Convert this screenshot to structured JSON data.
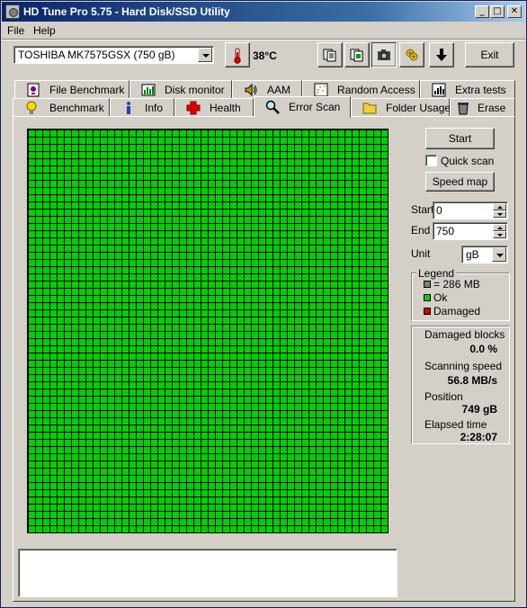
{
  "window": {
    "title": "HD Tune Pro 5.75 - Hard Disk/SSD Utility",
    "controls": [
      "_",
      "□",
      "✕"
    ]
  },
  "menu": [
    "File",
    "Help"
  ],
  "toolbar": {
    "drive": "TOSHIBA MK7575GSX (750 gB)",
    "temperature": "38",
    "temperature_unit": "°C",
    "exit_label": "Exit",
    "icons": [
      "copy-text-icon",
      "copy-screenshot-icon",
      "camera-icon",
      "options-icon",
      "save-icon"
    ]
  },
  "tabs_row1": [
    {
      "label": "File Benchmark",
      "icon": "file-benchmark-icon"
    },
    {
      "label": "Disk monitor",
      "icon": "disk-monitor-icon"
    },
    {
      "label": "AAM",
      "icon": "speaker-icon"
    },
    {
      "label": "Random Access",
      "icon": "random-access-icon"
    },
    {
      "label": "Extra tests",
      "icon": "extra-tests-icon"
    }
  ],
  "tabs_row2": [
    {
      "label": "Benchmark",
      "icon": "bulb-icon"
    },
    {
      "label": "Info",
      "icon": "info-icon"
    },
    {
      "label": "Health",
      "icon": "health-cross-icon"
    },
    {
      "label": "Error Scan",
      "icon": "magnifier-icon",
      "active": true
    },
    {
      "label": "Folder Usage",
      "icon": "folder-icon"
    },
    {
      "label": "Erase",
      "icon": "trash-icon"
    }
  ],
  "scan": {
    "start_button": "Start",
    "quick_scan_label": "Quick scan",
    "quick_scan_checked": false,
    "speed_map_button": "Speed map",
    "start_label": "Start",
    "start_value": "0",
    "end_label": "End",
    "end_value": "750",
    "unit_label": "Unit",
    "unit_value": "gB",
    "grid": {
      "columns": 50,
      "rows": 56,
      "ok_color": "#00d000",
      "damaged_color": "#d00000",
      "block_color": "#808080"
    }
  },
  "legend": {
    "title": "Legend",
    "items": [
      {
        "label": "= 286 MB",
        "color": "#808080"
      },
      {
        "label": "Ok",
        "color": "#00d000"
      },
      {
        "label": "Damaged",
        "color": "#d00000"
      }
    ]
  },
  "stats": {
    "damaged_label": "Damaged blocks",
    "damaged_value": "0.0 %",
    "speed_label": "Scanning speed",
    "speed_value": "56.8 MB/s",
    "position_label": "Position",
    "position_value": "749 gB",
    "elapsed_label": "Elapsed time",
    "elapsed_value": "2:28:07"
  }
}
